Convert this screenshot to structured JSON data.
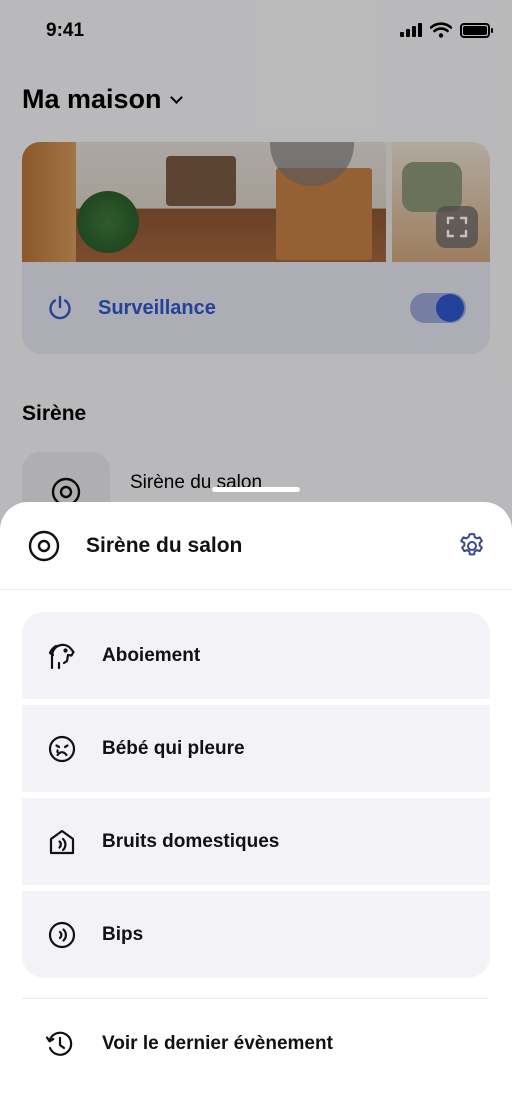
{
  "status_bar": {
    "time": "9:41"
  },
  "home": {
    "title": "Ma maison"
  },
  "surveillance": {
    "label": "Surveillance",
    "enabled": true,
    "accent": "#2f56c9"
  },
  "section": {
    "title": "Sirène"
  },
  "device": {
    "name": "Sirène du salon"
  },
  "sheet": {
    "title": "Sirène du salon",
    "options": [
      {
        "label": "Aboiement",
        "icon": "dog-icon"
      },
      {
        "label": "Bébé qui pleure",
        "icon": "crying-face-icon"
      },
      {
        "label": "Bruits domestiques",
        "icon": "house-sound-icon"
      },
      {
        "label": "Bips",
        "icon": "beep-icon"
      }
    ],
    "last_event": {
      "label": "Voir le dernier évènement",
      "icon": "history-icon"
    }
  }
}
